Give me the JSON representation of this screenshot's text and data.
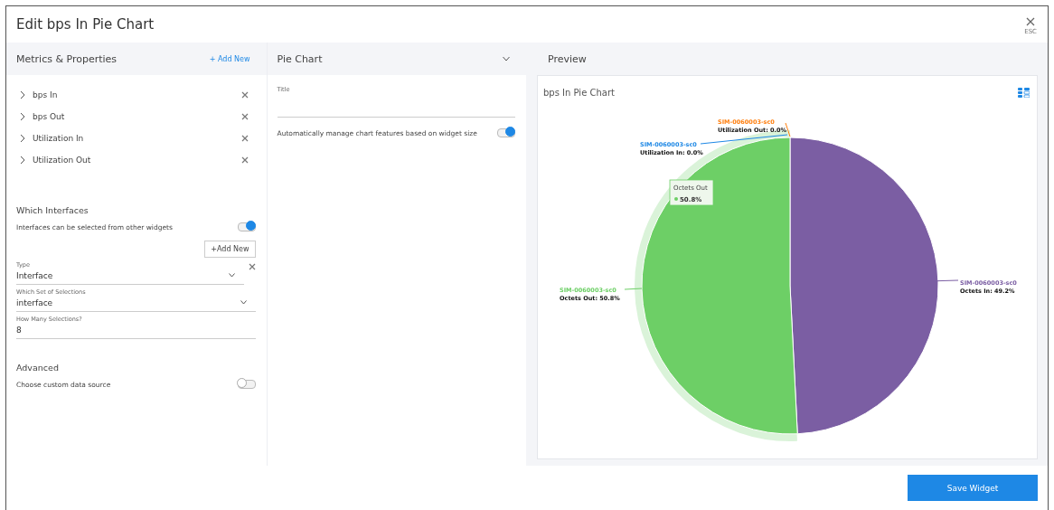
{
  "dialog": {
    "title": "Edit bps In Pie Chart",
    "close_label": "ESC"
  },
  "metrics_panel": {
    "title": "Metrics & Properties",
    "add_link": "+ Add New",
    "metrics": [
      {
        "label": "bps In",
        "expanded": false
      },
      {
        "label": "bps Out",
        "expanded": false
      },
      {
        "label": "Utilization In",
        "expanded": false
      },
      {
        "label": "Utilization Out",
        "expanded": false
      }
    ],
    "interfaces": {
      "title": "Which Interfaces",
      "toggle_label": "Interfaces can be selected from other widgets",
      "toggle_on": true,
      "add_button": "+Add New",
      "fields": [
        {
          "kind": "select",
          "label": "Type",
          "value": "Interface",
          "removable": true
        },
        {
          "kind": "select",
          "label": "Which Set of Selections",
          "value": "interface",
          "removable": false
        },
        {
          "kind": "input",
          "label": "How Many Selections?",
          "value": "8",
          "removable": false
        }
      ]
    },
    "advanced": {
      "title": "Advanced",
      "toggle_label": "Choose custom data source",
      "toggle_on": false
    }
  },
  "chart_panel": {
    "title": "Pie Chart",
    "title_field_label": "Title",
    "auto_label": "Automatically manage chart features based on widget size",
    "auto_on": true
  },
  "preview": {
    "title": "Preview",
    "tooltip": {
      "title": "Octets Out",
      "value": "50.8%",
      "color": "#6dcf66"
    },
    "chart_data": {
      "type": "pie",
      "title": "bps In Pie Chart",
      "series": [
        {
          "name": "SIM-0060003-sc0",
          "values": [
            49.2,
            50.8,
            0,
            0
          ]
        }
      ],
      "colors": [
        "#7b5ea3",
        "#6dcf66",
        "#1e88e5",
        "#ff7f0e"
      ],
      "value_labels": [
        "Octets In: 49.2%",
        "Octets Out: 50.8%",
        "Utilization In: 0.0%",
        "Utilization Out: 0.0%"
      ]
    }
  },
  "footer": {
    "save_button": "Save Widget"
  }
}
